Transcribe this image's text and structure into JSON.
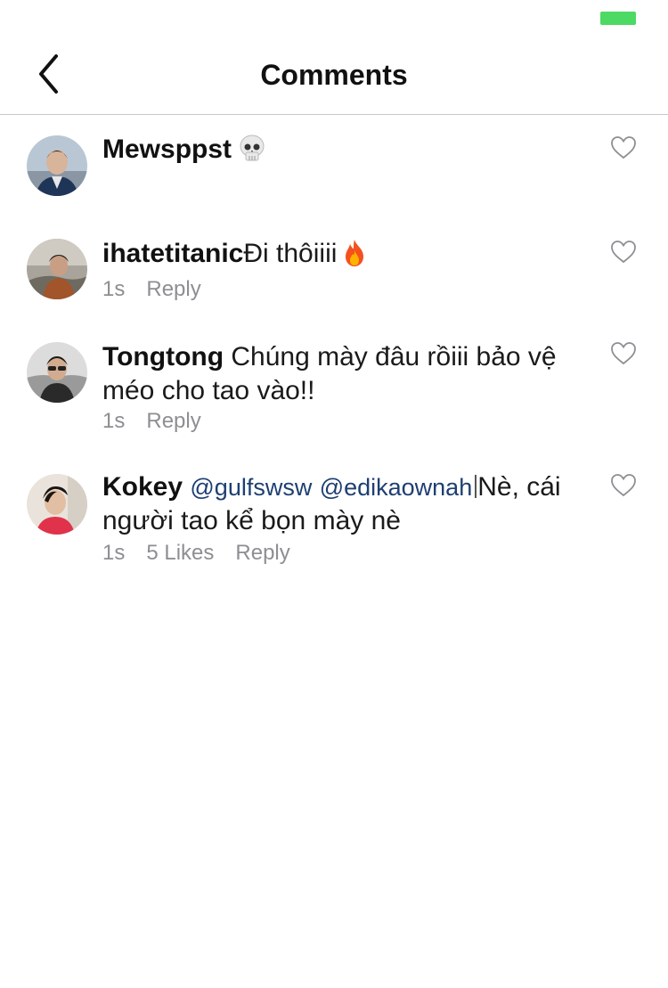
{
  "status_bar": {
    "battery_color": "#4cd964"
  },
  "nav": {
    "title": "Comments",
    "back_icon": "chevron-left-icon"
  },
  "comments": [
    {
      "username": "Mewsppst",
      "text": "",
      "emoji": "skull-emoji",
      "time": "",
      "likes": "",
      "reply": ""
    },
    {
      "username": "ihatetitanic",
      "text": "Đi thôiiii",
      "emoji": "fire-emoji",
      "time": "1s",
      "likes": "",
      "reply": "Reply"
    },
    {
      "username": "Tongtong",
      "text": "Chúng mày đâu rồiii bảo vệ méo cho tao vào!!",
      "time": "1s",
      "likes": "",
      "reply": "Reply"
    },
    {
      "username": "Kokey",
      "mention1": "@gulfswsw",
      "mention2": "@edikaownah",
      "text": "Nè, cái người tao kể bọn mày nè",
      "time": "1s",
      "likes": "5 Likes",
      "reply": "Reply"
    }
  ],
  "colors": {
    "mention": "#1d3f72",
    "meta": "#8e8e93",
    "divider": "#c8c8cc"
  }
}
